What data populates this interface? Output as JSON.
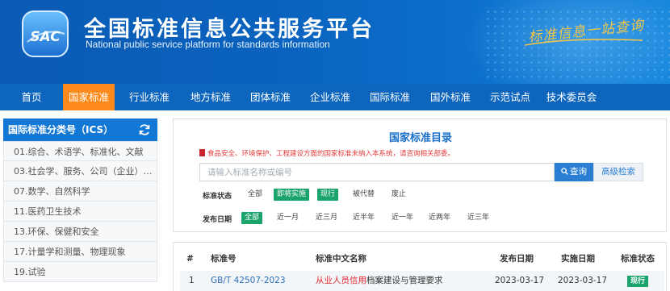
{
  "header": {
    "logo_text": "SAC",
    "title": "全国标准信息公共服务平台",
    "subtitle": "National public service platform  for standards information",
    "slogan": "标准信息一站查询"
  },
  "nav": {
    "items": [
      {
        "label": "首页"
      },
      {
        "label": "国家标准"
      },
      {
        "label": "行业标准"
      },
      {
        "label": "地方标准"
      },
      {
        "label": "团体标准"
      },
      {
        "label": "企业标准"
      },
      {
        "label": "国际标准"
      },
      {
        "label": "国外标准"
      },
      {
        "label": "示范试点"
      },
      {
        "label": "技术委员会"
      }
    ],
    "active_index": 1,
    "active_color": "#ff8a1c",
    "bar_color": "#0d65bd"
  },
  "sidebar": {
    "title": "国际标准分类号（ICS）",
    "items": [
      {
        "label": "01.综合、术语学、标准化、文献"
      },
      {
        "label": "03.社会学、服务、公司（企业）的组..."
      },
      {
        "label": "07.数学、自然科学"
      },
      {
        "label": "11.医药卫生技术"
      },
      {
        "label": "13.环保、保健和安全"
      },
      {
        "label": "17.计量学和测量、物理现象"
      },
      {
        "label": "19.试验"
      }
    ]
  },
  "catalog": {
    "title": "国家标准目录",
    "notice": "食品安全、环境保护、工程建设方面的国家标准未纳入本系统，请咨询相关部委。",
    "search": {
      "placeholder": "请输入标准名称或编号",
      "value": "",
      "button_label": "查询",
      "advanced_label": "高级检索"
    },
    "status_filter": {
      "label": "标准状态",
      "options": [
        "全部",
        "即将实施",
        "现行",
        "被代替",
        "废止"
      ],
      "selected": [
        "即将实施",
        "现行"
      ]
    },
    "date_filter": {
      "label": "发布日期",
      "options": [
        "全部",
        "近一月",
        "近三月",
        "近半年",
        "近一年",
        "近两年",
        "近三年"
      ],
      "selected": [
        "全部"
      ]
    }
  },
  "table": {
    "headers": [
      "#",
      "标准号",
      "标准中文名称",
      "发布日期",
      "实施日期",
      "标准状态"
    ],
    "rows": [
      {
        "index": "1",
        "code": "GB/T 42507-2023",
        "name_highlight": "从业人员信用",
        "name_rest": "档案建设与管理要求",
        "publish_date": "2023-03-17",
        "effective_date": "2023-03-17",
        "status": "现行"
      }
    ]
  },
  "colors": {
    "brand_blue": "#1377d6",
    "accent_orange": "#ff8a1c",
    "status_green": "#1aa36b",
    "notice_red": "#e23b3b"
  }
}
